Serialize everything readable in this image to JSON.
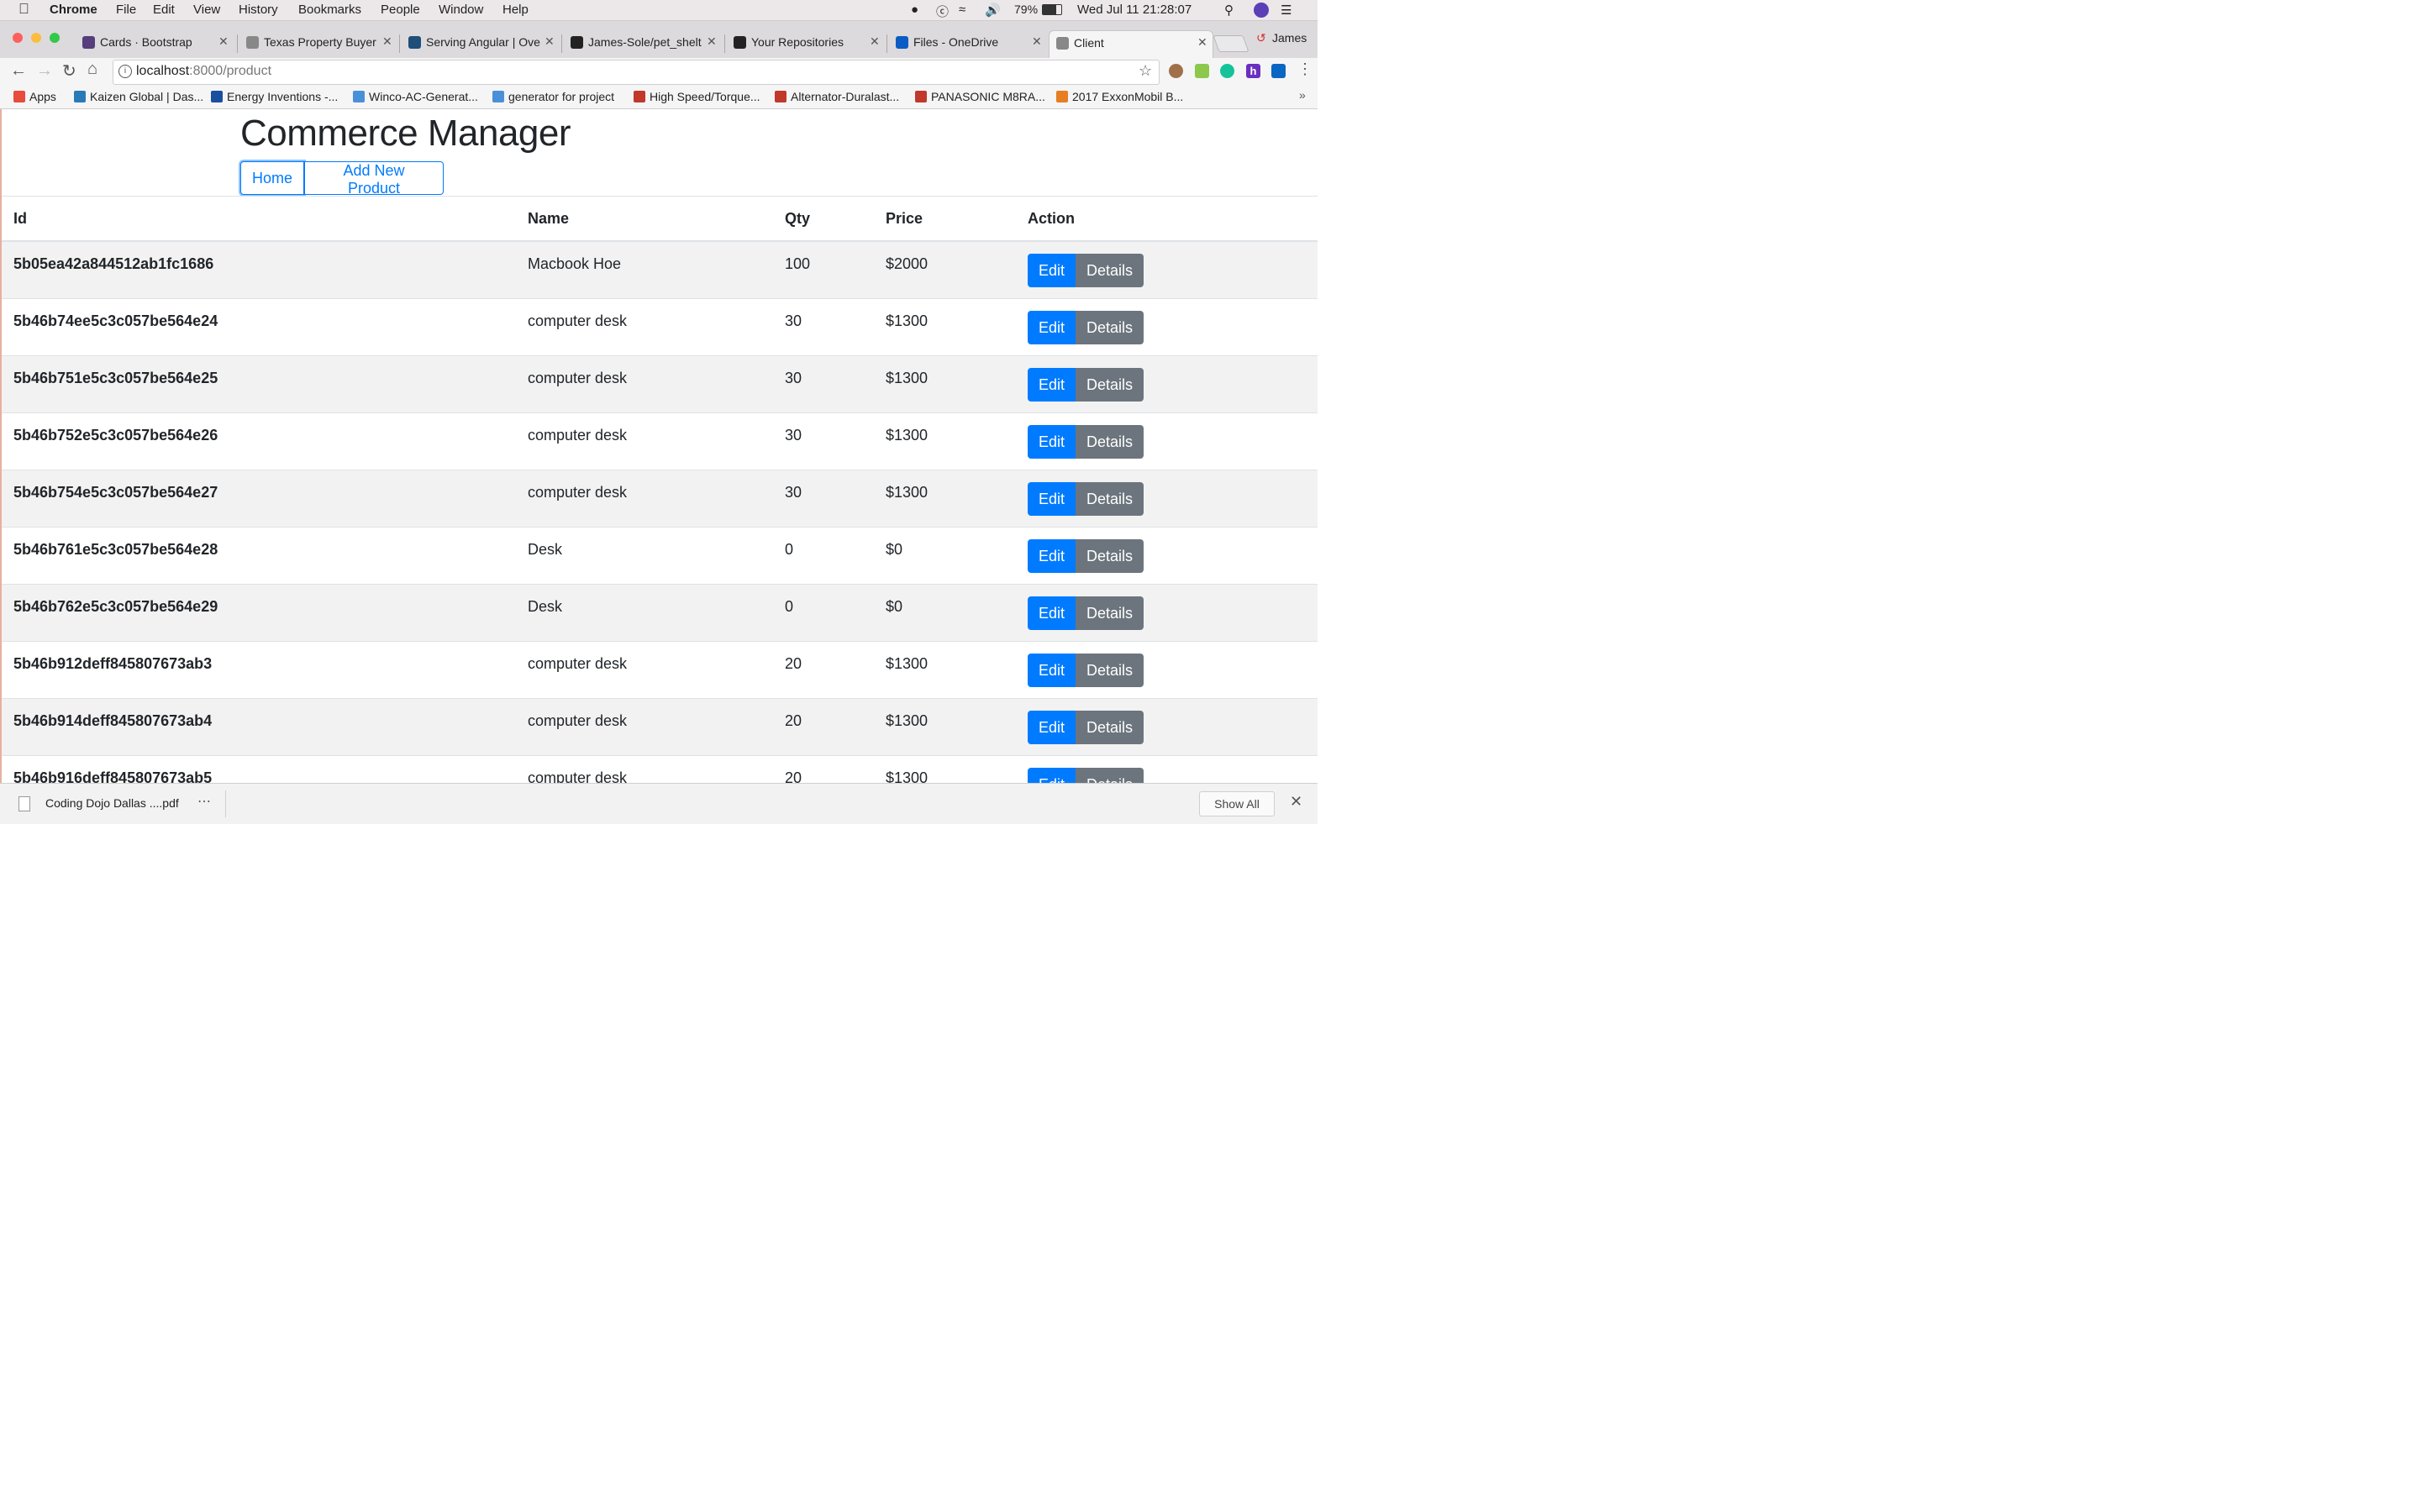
{
  "menubar": {
    "app": "Chrome",
    "items": [
      "File",
      "Edit",
      "View",
      "History",
      "Bookmarks",
      "People",
      "Window",
      "Help"
    ],
    "battery": "79%",
    "datetime": "Wed Jul 11  21:28:07"
  },
  "tabs": [
    {
      "label": "Cards · Bootstrap",
      "icon": "bootstrap-icon",
      "color": "#563d7c"
    },
    {
      "label": "Texas Property Buyer",
      "icon": "page-icon",
      "color": "#888888"
    },
    {
      "label": "Serving Angular | Ove",
      "icon": "angular-icon",
      "color": "#1f4e79"
    },
    {
      "label": "James-Sole/pet_shelt",
      "icon": "github-icon",
      "color": "#222222"
    },
    {
      "label": "Your Repositories",
      "icon": "github-icon",
      "color": "#222222"
    },
    {
      "label": "Files - OneDrive",
      "icon": "onedrive-icon",
      "color": "#0a5bc4"
    },
    {
      "label": "Client",
      "icon": "page-icon",
      "color": "#888888",
      "active": true
    }
  ],
  "profile_name": "James",
  "address": {
    "host": "localhost",
    "path": ":8000/product"
  },
  "bookmarks": [
    {
      "label": "Apps",
      "color": "#e74c3c"
    },
    {
      "label": "Kaizen Global | Das...",
      "color": "#2a7ab8"
    },
    {
      "label": "Energy Inventions -...",
      "color": "#1a4fa0"
    },
    {
      "label": "Winco-AC-Generat...",
      "color": "#4a90d9"
    },
    {
      "label": "generator for project",
      "color": "#4a90d9"
    },
    {
      "label": "High Speed/Torque...",
      "color": "#c0392b"
    },
    {
      "label": "Alternator-Duralast...",
      "color": "#c0392b"
    },
    {
      "label": "PANASONIC M8RA...",
      "color": "#c0392b"
    },
    {
      "label": "2017 ExxonMobil B...",
      "color": "#e67e22"
    }
  ],
  "page": {
    "title": "Commerce Manager",
    "home_label": "Home",
    "add_label": "Add New Product",
    "columns": [
      "Id",
      "Name",
      "Qty",
      "Price",
      "Action"
    ],
    "edit_label": "Edit",
    "details_label": "Details",
    "rows": [
      {
        "id": "5b05ea42a844512ab1fc1686",
        "name": "Macbook Hoe",
        "qty": "100",
        "price": "$2000"
      },
      {
        "id": "5b46b74ee5c3c057be564e24",
        "name": "computer desk",
        "qty": "30",
        "price": "$1300"
      },
      {
        "id": "5b46b751e5c3c057be564e25",
        "name": "computer desk",
        "qty": "30",
        "price": "$1300"
      },
      {
        "id": "5b46b752e5c3c057be564e26",
        "name": "computer desk",
        "qty": "30",
        "price": "$1300"
      },
      {
        "id": "5b46b754e5c3c057be564e27",
        "name": "computer desk",
        "qty": "30",
        "price": "$1300"
      },
      {
        "id": "5b46b761e5c3c057be564e28",
        "name": "Desk",
        "qty": "0",
        "price": "$0"
      },
      {
        "id": "5b46b762e5c3c057be564e29",
        "name": "Desk",
        "qty": "0",
        "price": "$0"
      },
      {
        "id": "5b46b912deff845807673ab3",
        "name": "computer desk",
        "qty": "20",
        "price": "$1300"
      },
      {
        "id": "5b46b914deff845807673ab4",
        "name": "computer desk",
        "qty": "20",
        "price": "$1300"
      },
      {
        "id": "5b46b916deff845807673ab5",
        "name": "computer desk",
        "qty": "20",
        "price": "$1300"
      }
    ]
  },
  "download": {
    "filename": "Coding Dojo Dallas ....pdf",
    "show_all": "Show All"
  }
}
